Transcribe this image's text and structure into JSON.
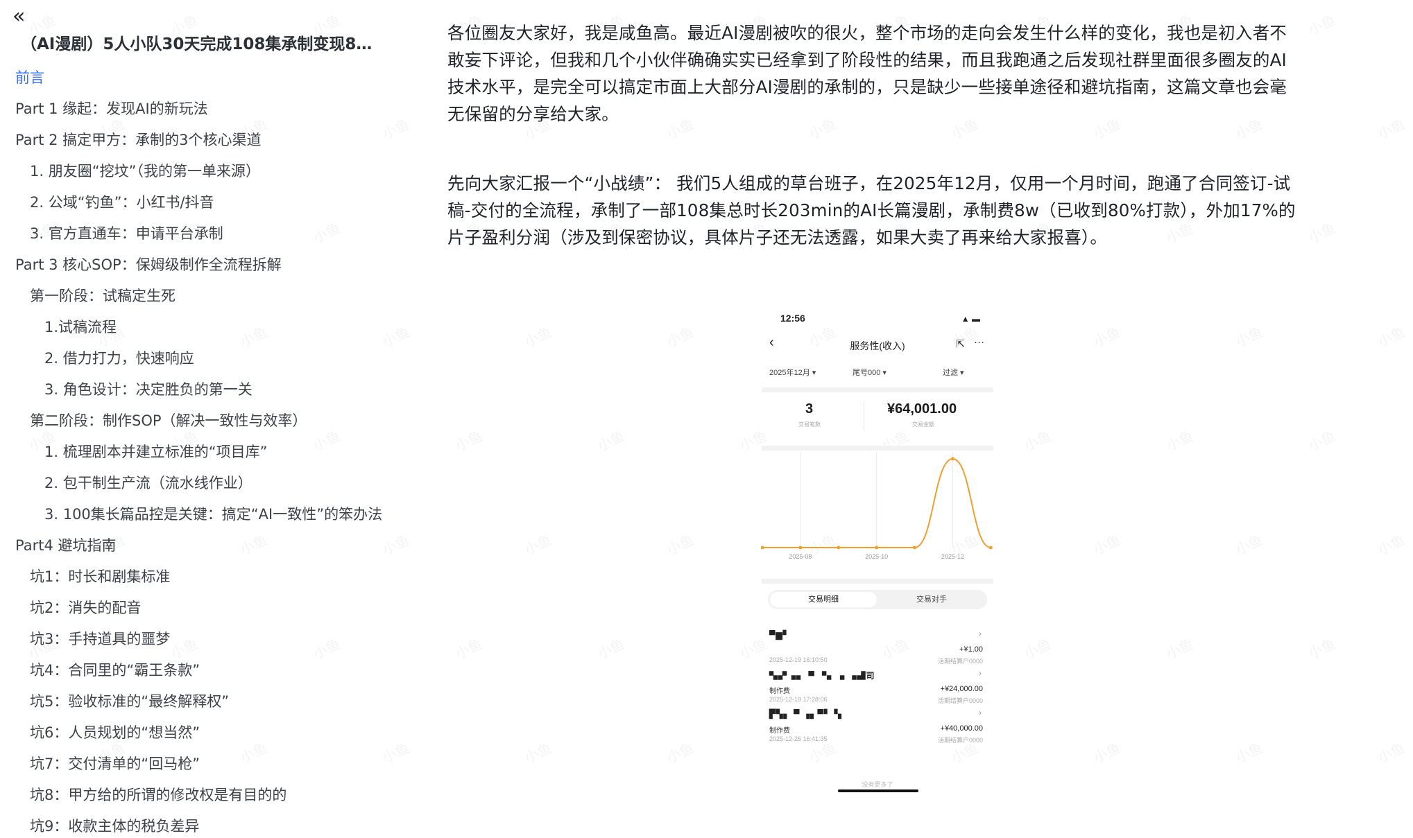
{
  "sidebar": {
    "collapse_icon": "«",
    "doc_title": "（AI漫剧）5人小队30天完成108集承制变现8W...",
    "outline": [
      {
        "label": "前言",
        "level": 1,
        "active": true
      },
      {
        "label": "Part 1 缘起：发现AI的新玩法",
        "level": 1
      },
      {
        "label": "Part 2 搞定甲方：承制的3个核心渠道",
        "level": 1
      },
      {
        "label": "1. 朋友圈“挖坟”（我的第一单来源）",
        "level": 2
      },
      {
        "label": "2. 公域“钓鱼”：小红书/抖音",
        "level": 2
      },
      {
        "label": "3. 官方直通车：申请平台承制",
        "level": 2
      },
      {
        "label": "Part 3 核心SOP：保姆级制作全流程拆解",
        "level": 1
      },
      {
        "label": "第一阶段：试稿定生死",
        "level": 2
      },
      {
        "label": "1.试稿流程",
        "level": 3
      },
      {
        "label": "2. 借力打力，快速响应",
        "level": 3
      },
      {
        "label": "3. 角色设计：决定胜负的第一关",
        "level": 3
      },
      {
        "label": "第二阶段：制作SOP（解决一致性与效率）",
        "level": 2
      },
      {
        "label": "1. 梳理剧本并建立标准的“项目库”",
        "level": 3
      },
      {
        "label": "2. 包干制生产流（流水线作业）",
        "level": 3
      },
      {
        "label": "3. 100集长篇品控是关键：搞定“AI一致性”的笨办法",
        "level": 3
      },
      {
        "label": "Part4 避坑指南",
        "level": 1
      },
      {
        "label": "坑1：时长和剧集标准",
        "level": 2
      },
      {
        "label": "坑2：消失的配音",
        "level": 2
      },
      {
        "label": "坑3：手持道具的噩梦",
        "level": 2
      },
      {
        "label": "坑4：合同里的“霸王条款”",
        "level": 2
      },
      {
        "label": "坑5：验收标准的“最终解释权”",
        "level": 2
      },
      {
        "label": "坑6：人员规划的“想当然”",
        "level": 2
      },
      {
        "label": "坑7：交付清单的“回马枪”",
        "level": 2
      },
      {
        "label": "坑8：甲方给的所谓的修改权是有目的的",
        "level": 2
      },
      {
        "label": "坑9：收款主体的税负差异",
        "level": 2
      }
    ]
  },
  "article": {
    "paragraphs": [
      "各位圈友大家好，我是咸鱼高。最近AI漫剧被吹的很火，整个市场的走向会发生什么样的变化，我也是初入者不敢妄下评论，但我和几个小伙伴确确实实已经拿到了阶段性的结果，而且我跑通之后发现社群里面很多圈友的AI技术水平，是完全可以搞定市面上大部分AI漫剧的承制的，只是缺少一些接单途径和避坑指南，这篇文章也会毫无保留的分享给大家。",
      "先向大家汇报一个“小战绩”： 我们5人组成的草台班子，在2025年12月，仅用一个月时间，跑通了合同签订-试稿-交付的全流程，承制了一部108集总时长203min的AI长篇漫剧，承制费8w（已收到80%打款），外加17%的片子盈利分润（涉及到保密协议，具体片子还无法透露，如果大卖了再来给大家报喜）。"
    ]
  },
  "phone": {
    "status_time": "12:56",
    "status_icons": "▲ ▬",
    "back_icon": "‹",
    "nav_title": "服务性(收入)",
    "share_icon": "⇱",
    "more_icon": "···",
    "filters": [
      "2025年12月 ▾",
      "尾号000 ▾",
      "过滤 ▾"
    ],
    "stat_count": "3",
    "stat_count_label": "交易笔数",
    "stat_amount": "¥64,001.00",
    "stat_amount_label": "交易金额",
    "tabs": [
      "交易明细",
      "交易对手"
    ],
    "transactions": [
      {
        "mask": "▀▆▘",
        "category": "",
        "amount": "+¥1.00",
        "time": "2025-12-19 16:10:50",
        "account": "活期结算户0000"
      },
      {
        "mask": "▚▞▗▖  ▀ ▝▖▗  ▗▟司",
        "category": "制作费",
        "amount": "+¥24,000.00",
        "time": "2025-12-19 17:28:06",
        "account": "活期结算户0000"
      },
      {
        "mask": "▛▚▖  ▀ ▗▖▀▘▝▖",
        "category": "制作费",
        "amount": "+¥40,000.00",
        "time": "2025-12-26 16:41:35",
        "account": "活期结算户0000"
      }
    ],
    "no_more": "没有更多了",
    "watermark": "小鱼"
  },
  "chart_data": {
    "type": "line",
    "x": [
      "2025-07",
      "2025-08",
      "2025-09",
      "2025-10",
      "2025-11",
      "2025-12",
      "2026-01"
    ],
    "x_tick_labels": [
      "2025-08",
      "2025-10",
      "2025-12"
    ],
    "values": [
      0,
      0,
      0,
      0,
      0,
      64001,
      1
    ],
    "color": "#f0a030"
  }
}
